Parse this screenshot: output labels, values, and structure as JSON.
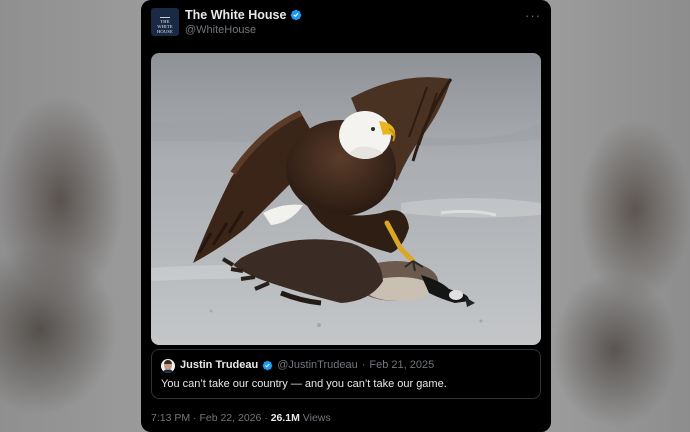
{
  "tweet": {
    "display_name": "The White House",
    "handle": "@WhiteHouse",
    "avatar_text": [
      "THE",
      "WHITE",
      "HOUSE"
    ],
    "more_label": "···",
    "image": {
      "subject": "Bald eagle standing on a Canada goose on ice"
    },
    "quote": {
      "display_name": "Justin Trudeau",
      "handle": "@JustinTrudeau",
      "separator": "·",
      "date": "Feb 21, 2025",
      "text": "You can’t take our country — and you can’t take our game."
    },
    "meta": {
      "time": "7:13 PM",
      "separator": "·",
      "date": "Feb 22, 2026",
      "views_count": "26.1M",
      "views_label": "Views"
    }
  },
  "colors": {
    "card_bg": "#000000",
    "text_primary": "#e7e9ea",
    "text_secondary": "#71767b",
    "verified_badge": "#1d9bf0",
    "border": "#2f3336"
  }
}
